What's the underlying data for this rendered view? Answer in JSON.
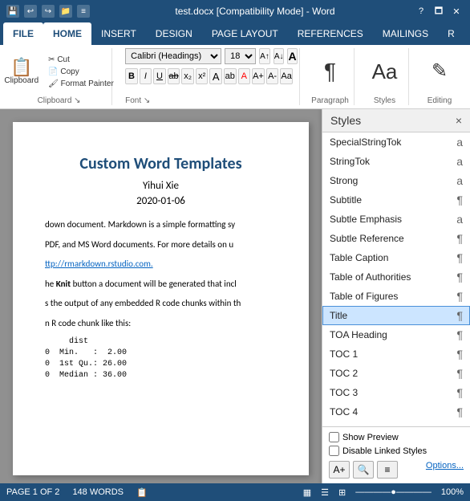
{
  "titlebar": {
    "icons": [
      "💾",
      "↩",
      "↪",
      "📁",
      "≡"
    ],
    "title": "test.docx [Compatibility Mode] - Word",
    "controls": [
      "?",
      "🗖",
      "✕"
    ]
  },
  "ribbon": {
    "tabs": [
      "FILE",
      "HOME",
      "INSERT",
      "DESIGN",
      "PAGE LAYOUT",
      "REFERENCES",
      "MAILINGS",
      "R"
    ],
    "active_tab": "HOME",
    "font_name": "Calibri (Headings)",
    "font_size": "18",
    "groups": [
      "Clipboard",
      "Font",
      "Paragraph",
      "Styles",
      "Editing"
    ]
  },
  "document": {
    "title": "Custom Word Templates",
    "author": "Yihui Xie",
    "date": "2020-01-06",
    "paragraphs": [
      "down document. Markdown is a simple formatting sy",
      "PDF, and MS Word documents. For more details on u",
      "ttp://rmarkdown.rstudio.com.",
      "",
      "he Knit button a document will be generated that incl",
      "s the output of any embedded R code chunks within th",
      "n R code chunk like this:",
      "",
      "     dist",
      "0  Min.   :  2.00",
      "0  1st Qu.: 26.00",
      "0  Median : 36.00"
    ],
    "link_text": "ttp://rmarkdown.rstudio.com."
  },
  "styles_panel": {
    "title": "Styles",
    "close_label": "×",
    "items": [
      {
        "name": "SpecialStringTok",
        "indicator": "a",
        "selected": false
      },
      {
        "name": "StringTok",
        "indicator": "a",
        "selected": false
      },
      {
        "name": "Strong",
        "indicator": "a",
        "selected": false
      },
      {
        "name": "Subtitle",
        "indicator": "¶",
        "selected": false
      },
      {
        "name": "Subtle Emphasis",
        "indicator": "a",
        "selected": false
      },
      {
        "name": "Subtle Reference",
        "indicator": "¶",
        "selected": false
      },
      {
        "name": "Table Caption",
        "indicator": "¶",
        "selected": false
      },
      {
        "name": "Table of Authorities",
        "indicator": "¶",
        "selected": false
      },
      {
        "name": "Table of Figures",
        "indicator": "¶",
        "selected": false
      },
      {
        "name": "Title",
        "indicator": "¶",
        "selected": true
      },
      {
        "name": "TOA Heading",
        "indicator": "¶",
        "selected": false
      },
      {
        "name": "TOC 1",
        "indicator": "¶",
        "selected": false
      },
      {
        "name": "TOC 2",
        "indicator": "¶",
        "selected": false
      },
      {
        "name": "TOC 3",
        "indicator": "¶",
        "selected": false
      },
      {
        "name": "TOC 4",
        "indicator": "¶",
        "selected": false
      }
    ],
    "show_preview_label": "Show Preview",
    "disable_linked_label": "Disable Linked Styles",
    "options_label": "Options..."
  },
  "statusbar": {
    "page": "PAGE 1 OF 2",
    "words": "148 WORDS",
    "zoom": "100%"
  }
}
